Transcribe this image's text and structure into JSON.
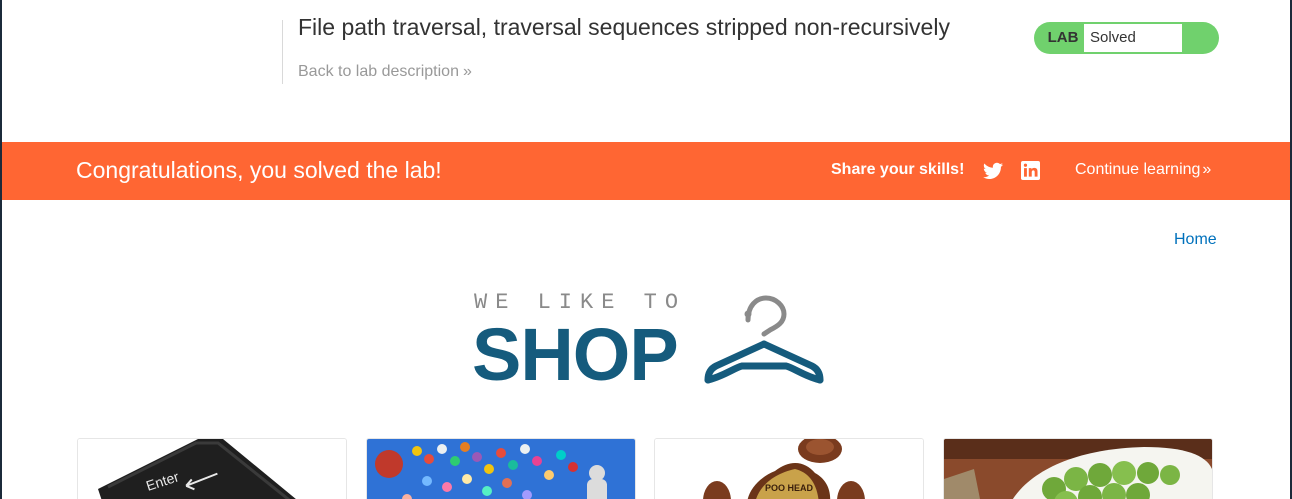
{
  "header": {
    "lab_title": "File path traversal, traversal sequences stripped non-recursively",
    "back_link": "Back to lab description",
    "status_badge_label": "LAB",
    "status_value": "Solved"
  },
  "banner": {
    "message": "Congratulations, you solved the lab!",
    "share_label": "Share your skills!",
    "continue_link": "Continue learning"
  },
  "nav": {
    "home_link": "Home"
  },
  "logo": {
    "tagline": "WE LIKE TO",
    "word": "SHOP"
  },
  "products": [
    {
      "image": "keyboard-enter-key",
      "key_label": "Enter"
    },
    {
      "image": "balloons"
    },
    {
      "image": "poo-head-game",
      "label": "POO HEAD"
    },
    {
      "image": "brussels-sprouts"
    }
  ],
  "colors": {
    "banner": "#ff6633",
    "lab_status": "#70d16d",
    "link": "#0071bc",
    "logo": "#155b7d"
  }
}
